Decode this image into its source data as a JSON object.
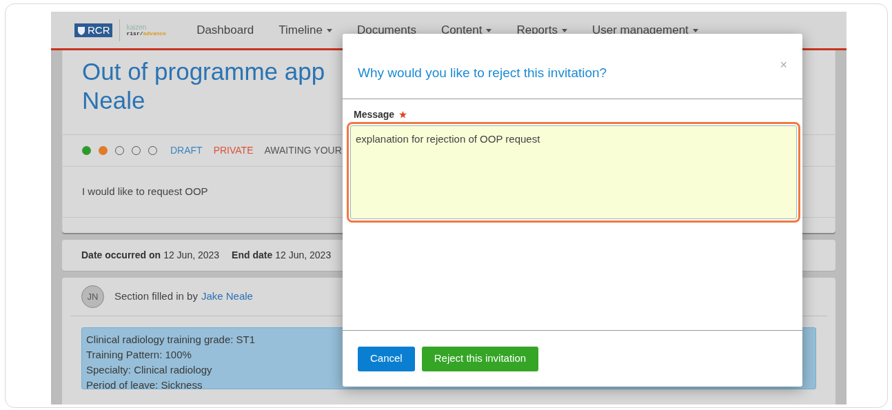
{
  "nav": {
    "logo": {
      "college": "RCR",
      "brand_top": "kaizen",
      "brand_bottom_a": "risr/",
      "brand_bottom_b": "advance"
    },
    "items": [
      {
        "label": "Dashboard",
        "dropdown": false
      },
      {
        "label": "Timeline",
        "dropdown": true
      },
      {
        "label": "Documents",
        "dropdown": false
      },
      {
        "label": "Content",
        "dropdown": true
      },
      {
        "label": "Reports",
        "dropdown": true
      },
      {
        "label": "User management",
        "dropdown": true
      }
    ]
  },
  "page": {
    "title_lines": [
      "Out of programme app",
      "Neale"
    ],
    "progress": [
      {
        "kind": "filled",
        "color": "#2e9a2e"
      },
      {
        "kind": "filled",
        "color": "#e07b28"
      },
      {
        "kind": "empty"
      },
      {
        "kind": "empty"
      },
      {
        "kind": "empty"
      }
    ],
    "tags": [
      {
        "label": "DRAFT",
        "color": "#3a86c0"
      },
      {
        "label": "PRIVATE",
        "color": "#d9533a"
      },
      {
        "label": "AWAITING YOUR",
        "color": "#555555"
      }
    ],
    "description": "I would like to request OOP",
    "dates": [
      {
        "label": "Date occurred on",
        "value": "12 Jun, 2023"
      },
      {
        "label": "End date",
        "value": "12 Jun, 2023"
      }
    ],
    "section": {
      "initials": "JN",
      "text": "Section filled in by",
      "author": "Jake Neale",
      "details": [
        "Clinical radiology training grade: ST1",
        "Training Pattern: 100%",
        "Specialty: Clinical radiology",
        "Period of leave: Sickness"
      ]
    }
  },
  "modal": {
    "title": "Why would you like to reject this invitation?",
    "close": "×",
    "field": {
      "label": "Message",
      "required": true,
      "value": "explanation for rejection of OOP request"
    },
    "buttons": [
      {
        "label": "Cancel",
        "kind": "secondary"
      },
      {
        "label": "Reject this invitation",
        "kind": "primary"
      }
    ]
  }
}
